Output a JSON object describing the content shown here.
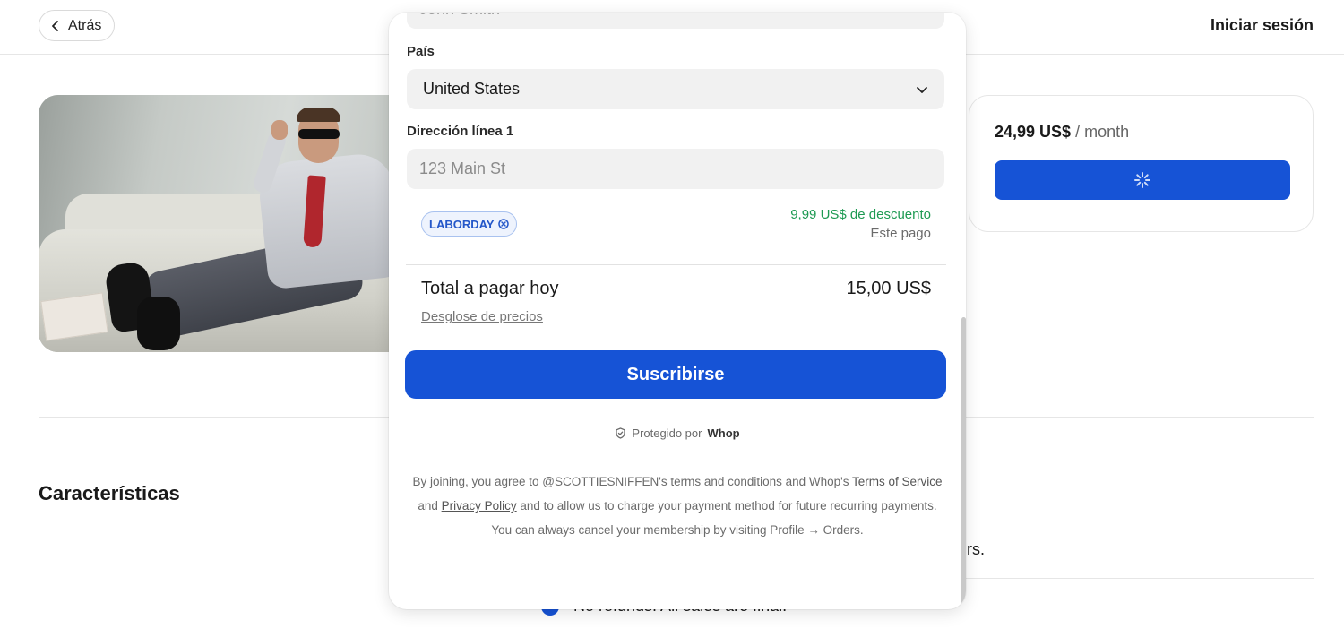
{
  "header": {
    "back_label": "Atrás",
    "login_label": "Iniciar sesión"
  },
  "pricing_card": {
    "price": "24,99 US$",
    "period": "/ month"
  },
  "features": {
    "title": "Características",
    "item_1_tail": "rs.",
    "item_2": "No refunds. All sales are final."
  },
  "checkout": {
    "name_value": "John Smith",
    "country_label": "País",
    "country_value": "United States",
    "address_label": "Dirección línea 1",
    "address_placeholder": "123 Main St",
    "coupon_code": "LABORDAY",
    "discount_amount": "9,99 US$ de descuento",
    "discount_scope": "Este pago",
    "total_label": "Total a pagar hoy",
    "total_value": "15,00 US$",
    "breakdown_link": "Desglose de precios",
    "subscribe_label": "Suscribirse",
    "protected_prefix": "Protegido por",
    "protected_brand": "Whop",
    "terms": {
      "part1": "By joining, you agree to @SCOTTIESNIFFEN's terms and conditions and Whop's ",
      "terms_link": "Terms of Service",
      "part2": " and ",
      "privacy_link": "Privacy Policy",
      "part3": " and to allow us to charge your payment method for future recurring payments. You can always cancel your membership by visiting Profile → Orders."
    }
  },
  "colors": {
    "primary": "#1653d6",
    "discount_green": "#1d9a52",
    "field_bg": "#f1f1f1"
  }
}
